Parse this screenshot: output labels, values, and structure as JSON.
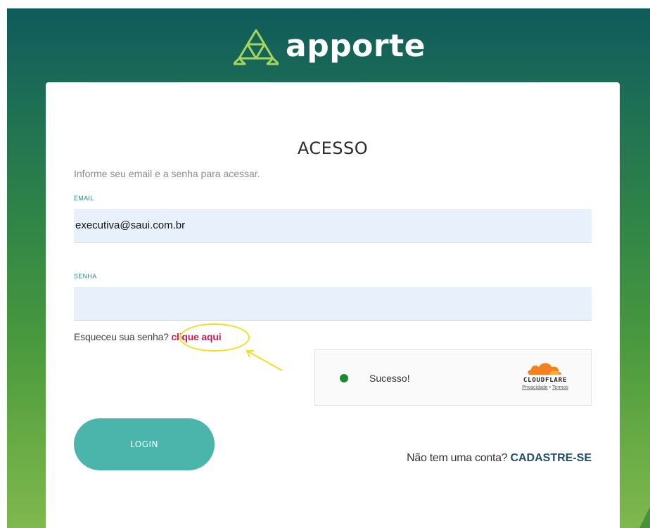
{
  "brand": {
    "name": "apporte",
    "logo_icon": "triangles-logo-icon",
    "colors": {
      "background_top": "#0f5a5c",
      "background_bottom": "#7fb84e",
      "logo_green": "#a4d65e",
      "accent_teal": "#4bb5ab",
      "link_red": "#d6184f",
      "link_navy": "#1e4f6d"
    }
  },
  "login": {
    "title": "ACESSO",
    "subtitle": "Informe seu email e a senha para acessar.",
    "email": {
      "label": "EMAIL",
      "value": "executiva@saui.com.br"
    },
    "password": {
      "label": "SENHA",
      "value": ""
    },
    "forgot": {
      "prefix": "Esqueceu sua senha?",
      "link": "clique aqui"
    },
    "button_label": "LOGIN",
    "signup": {
      "prefix": "Não tem uma conta?",
      "link": "CADASTRE-SE"
    }
  },
  "captcha": {
    "status": "Sucesso!",
    "status_icon": "success-dot-icon",
    "brand": "CLOUDFLARE",
    "privacy_link": "Privacidade",
    "separator": "•",
    "terms_link": "Termos"
  },
  "annotation": {
    "color": "#f0e020",
    "shapes": [
      "highlight-ellipse",
      "arrow-icon"
    ]
  }
}
